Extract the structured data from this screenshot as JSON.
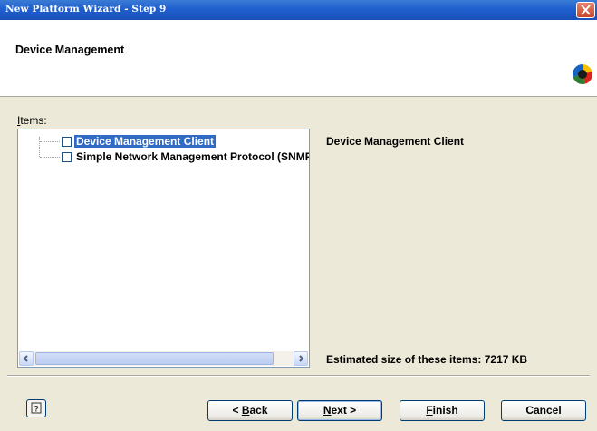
{
  "window": {
    "title": "New Platform Wizard - Step 9",
    "close_glyph": "✕"
  },
  "header": {
    "title": "Device Management"
  },
  "items": {
    "label_prefix": "",
    "label_accel": "I",
    "label_rest": "tems:",
    "entries": [
      {
        "label": "Device Management Client",
        "checked": false,
        "selected": true
      },
      {
        "label": "Simple Network Management Protocol (SNMP)",
        "checked": false,
        "selected": false
      }
    ]
  },
  "description": {
    "title": "Device Management Client",
    "estimated_size": "Estimated size of these items: 7217 KB"
  },
  "buttons": {
    "help_glyph": "?",
    "back_pre": "< ",
    "back_accel": "B",
    "back_post": "ack",
    "next_accel": "N",
    "next_post": "ext >",
    "finish_accel": "F",
    "finish_post": "inish",
    "cancel": "Cancel"
  },
  "colors": {
    "titlebar": "#1f5fcf",
    "selection": "#316ac5",
    "dialog_bg": "#ece9d8"
  }
}
